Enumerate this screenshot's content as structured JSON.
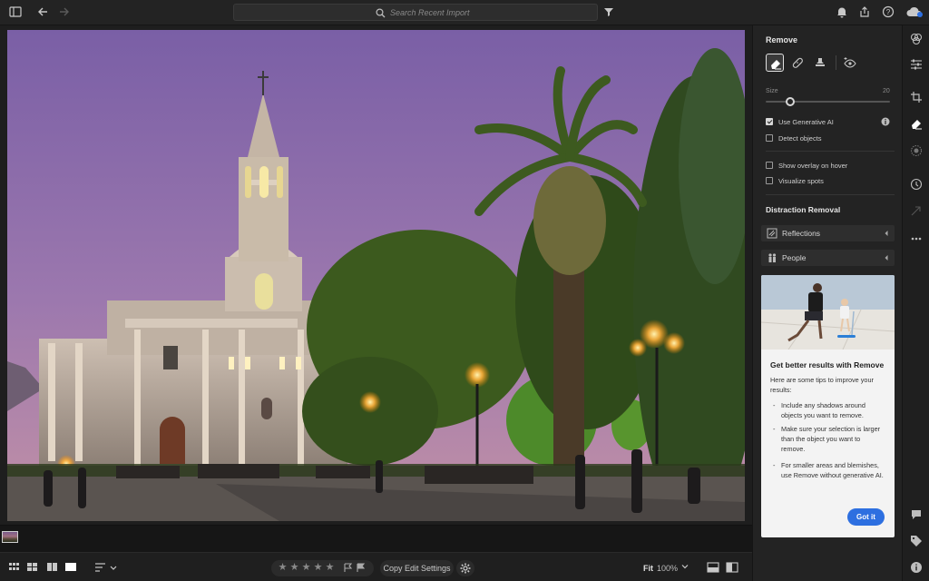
{
  "topbar": {
    "search_placeholder": "Search Recent Import"
  },
  "panel": {
    "title": "Remove",
    "size_label": "Size",
    "size_value": "20",
    "size_fraction": 0.2,
    "options": [
      {
        "label": "Use Generative AI",
        "checked": true
      },
      {
        "label": "Detect objects",
        "checked": false
      }
    ],
    "overlay_options": [
      {
        "label": "Show overlay on hover",
        "checked": false
      },
      {
        "label": "Visualize spots",
        "checked": false
      }
    ],
    "distraction_title": "Distraction Removal",
    "distraction_items": [
      {
        "label": "Reflections",
        "icon": "reflections-icon"
      },
      {
        "label": "People",
        "icon": "people-icon"
      }
    ],
    "tip": {
      "title": "Get better results with Remove",
      "intro": "Here are some tips to improve your results:",
      "items": [
        "Include any shadows around objects you want to remove.",
        "Make sure your selection is larger than the object you want to remove.",
        "For smaller areas and blemishes, use Remove without generative AI."
      ],
      "button": "Got it"
    }
  },
  "bottombar": {
    "copy_label": "Copy Edit Settings",
    "fit_label": "Fit",
    "zoom_label": "100%"
  },
  "colors": {
    "accent": "#2d6fe0",
    "panel_bg": "#232323",
    "sky_top": "#7d62a8",
    "sky_bottom": "#b88aa8"
  }
}
